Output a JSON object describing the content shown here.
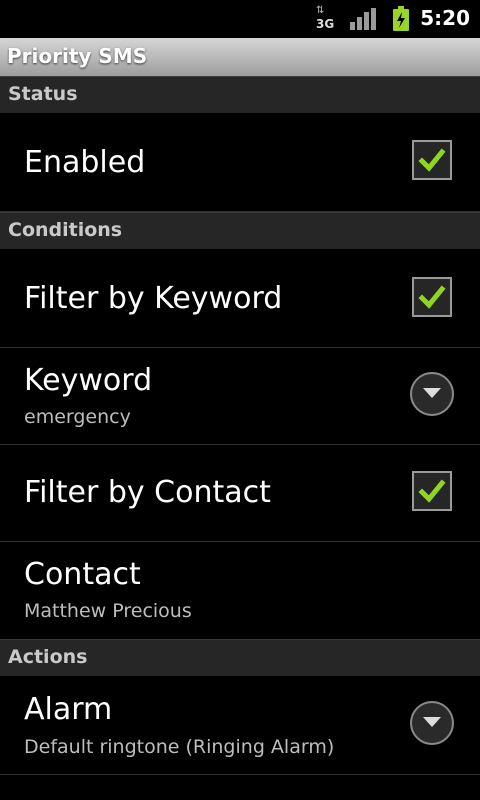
{
  "status_bar": {
    "network": "3G",
    "time": "5:20"
  },
  "app": {
    "title": "Priority SMS"
  },
  "sections": {
    "status": "Status",
    "conditions": "Conditions",
    "actions": "Actions"
  },
  "prefs": {
    "enabled": {
      "title": "Enabled",
      "checked": true
    },
    "filter_keyword": {
      "title": "Filter by Keyword",
      "checked": true
    },
    "keyword": {
      "title": "Keyword",
      "summary": "emergency"
    },
    "filter_contact": {
      "title": "Filter by Contact",
      "checked": true
    },
    "contact": {
      "title": "Contact",
      "summary": "Matthew Precious"
    },
    "alarm": {
      "title": "Alarm",
      "summary": "Default ringtone (Ringing Alarm)"
    }
  },
  "colors": {
    "check_green": "#8fd61f",
    "battery_green": "#9ad42a"
  }
}
